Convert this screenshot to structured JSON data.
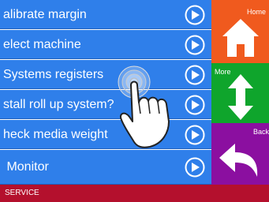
{
  "menu": {
    "items": [
      {
        "label": "alibrate margin",
        "arrow_icon": "chevron-right-circle-icon"
      },
      {
        "label": "elect machine",
        "arrow_icon": "chevron-right-circle-icon"
      },
      {
        "label": "Systems registers",
        "arrow_icon": "chevron-right-circle-icon"
      },
      {
        "label": "stall roll up system?",
        "arrow_icon": "chevron-right-circle-icon"
      },
      {
        "label": "heck media weight",
        "arrow_icon": "chevron-right-circle-icon"
      },
      {
        "label": " Monitor",
        "arrow_icon": "chevron-right-circle-icon"
      }
    ],
    "item_color": "#2f7fea"
  },
  "sidebar": {
    "home": {
      "label": "Home",
      "icon": "house-icon",
      "color": "#f05a1e"
    },
    "more": {
      "label": "More",
      "icon": "up-down-arrow-icon",
      "color": "#0fa52c"
    },
    "back": {
      "label": "Back",
      "icon": "back-arrow-icon",
      "color": "#8b0fa0"
    }
  },
  "footer": {
    "title": "SERVICE",
    "color": "#b4102d"
  },
  "overlay": {
    "icon": "touch-hand-icon"
  }
}
